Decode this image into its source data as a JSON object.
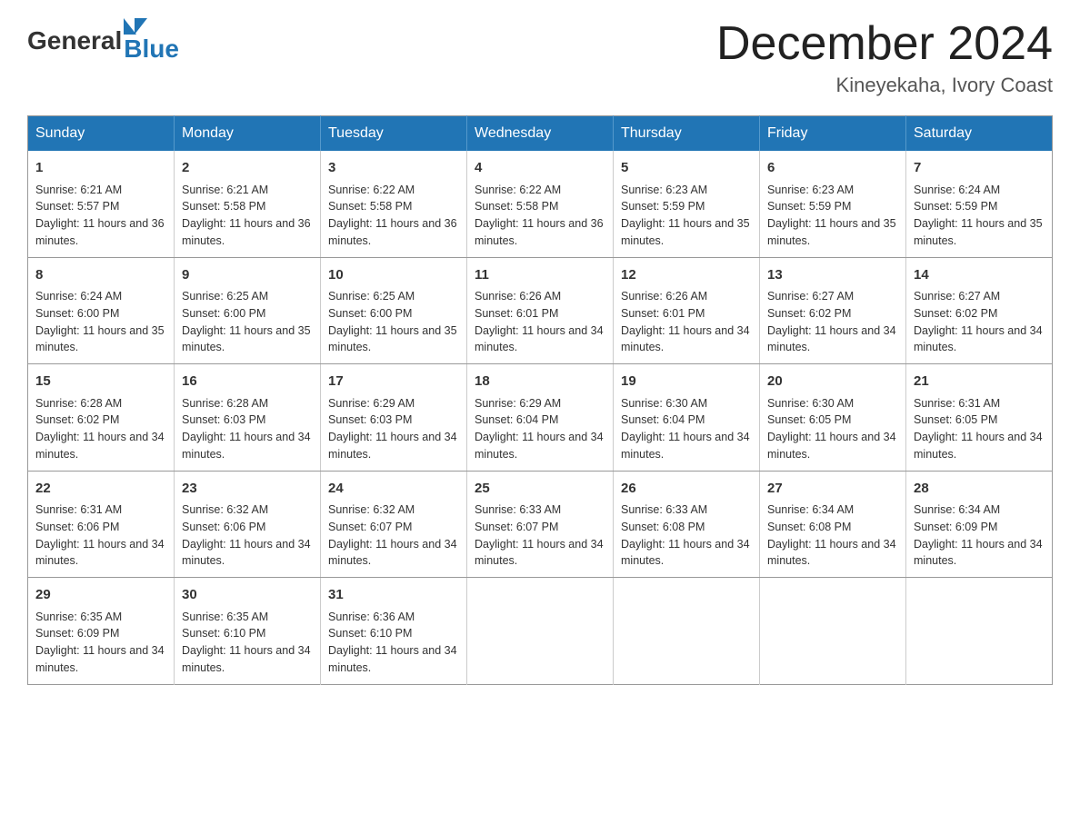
{
  "logo": {
    "general": "General",
    "blue": "Blue"
  },
  "title": "December 2024",
  "location": "Kineyekaha, Ivory Coast",
  "days_of_week": [
    "Sunday",
    "Monday",
    "Tuesday",
    "Wednesday",
    "Thursday",
    "Friday",
    "Saturday"
  ],
  "weeks": [
    [
      {
        "day": "1",
        "sunrise": "6:21 AM",
        "sunset": "5:57 PM",
        "daylight": "11 hours and 36 minutes."
      },
      {
        "day": "2",
        "sunrise": "6:21 AM",
        "sunset": "5:58 PM",
        "daylight": "11 hours and 36 minutes."
      },
      {
        "day": "3",
        "sunrise": "6:22 AM",
        "sunset": "5:58 PM",
        "daylight": "11 hours and 36 minutes."
      },
      {
        "day": "4",
        "sunrise": "6:22 AM",
        "sunset": "5:58 PM",
        "daylight": "11 hours and 36 minutes."
      },
      {
        "day": "5",
        "sunrise": "6:23 AM",
        "sunset": "5:59 PM",
        "daylight": "11 hours and 35 minutes."
      },
      {
        "day": "6",
        "sunrise": "6:23 AM",
        "sunset": "5:59 PM",
        "daylight": "11 hours and 35 minutes."
      },
      {
        "day": "7",
        "sunrise": "6:24 AM",
        "sunset": "5:59 PM",
        "daylight": "11 hours and 35 minutes."
      }
    ],
    [
      {
        "day": "8",
        "sunrise": "6:24 AM",
        "sunset": "6:00 PM",
        "daylight": "11 hours and 35 minutes."
      },
      {
        "day": "9",
        "sunrise": "6:25 AM",
        "sunset": "6:00 PM",
        "daylight": "11 hours and 35 minutes."
      },
      {
        "day": "10",
        "sunrise": "6:25 AM",
        "sunset": "6:00 PM",
        "daylight": "11 hours and 35 minutes."
      },
      {
        "day": "11",
        "sunrise": "6:26 AM",
        "sunset": "6:01 PM",
        "daylight": "11 hours and 34 minutes."
      },
      {
        "day": "12",
        "sunrise": "6:26 AM",
        "sunset": "6:01 PM",
        "daylight": "11 hours and 34 minutes."
      },
      {
        "day": "13",
        "sunrise": "6:27 AM",
        "sunset": "6:02 PM",
        "daylight": "11 hours and 34 minutes."
      },
      {
        "day": "14",
        "sunrise": "6:27 AM",
        "sunset": "6:02 PM",
        "daylight": "11 hours and 34 minutes."
      }
    ],
    [
      {
        "day": "15",
        "sunrise": "6:28 AM",
        "sunset": "6:02 PM",
        "daylight": "11 hours and 34 minutes."
      },
      {
        "day": "16",
        "sunrise": "6:28 AM",
        "sunset": "6:03 PM",
        "daylight": "11 hours and 34 minutes."
      },
      {
        "day": "17",
        "sunrise": "6:29 AM",
        "sunset": "6:03 PM",
        "daylight": "11 hours and 34 minutes."
      },
      {
        "day": "18",
        "sunrise": "6:29 AM",
        "sunset": "6:04 PM",
        "daylight": "11 hours and 34 minutes."
      },
      {
        "day": "19",
        "sunrise": "6:30 AM",
        "sunset": "6:04 PM",
        "daylight": "11 hours and 34 minutes."
      },
      {
        "day": "20",
        "sunrise": "6:30 AM",
        "sunset": "6:05 PM",
        "daylight": "11 hours and 34 minutes."
      },
      {
        "day": "21",
        "sunrise": "6:31 AM",
        "sunset": "6:05 PM",
        "daylight": "11 hours and 34 minutes."
      }
    ],
    [
      {
        "day": "22",
        "sunrise": "6:31 AM",
        "sunset": "6:06 PM",
        "daylight": "11 hours and 34 minutes."
      },
      {
        "day": "23",
        "sunrise": "6:32 AM",
        "sunset": "6:06 PM",
        "daylight": "11 hours and 34 minutes."
      },
      {
        "day": "24",
        "sunrise": "6:32 AM",
        "sunset": "6:07 PM",
        "daylight": "11 hours and 34 minutes."
      },
      {
        "day": "25",
        "sunrise": "6:33 AM",
        "sunset": "6:07 PM",
        "daylight": "11 hours and 34 minutes."
      },
      {
        "day": "26",
        "sunrise": "6:33 AM",
        "sunset": "6:08 PM",
        "daylight": "11 hours and 34 minutes."
      },
      {
        "day": "27",
        "sunrise": "6:34 AM",
        "sunset": "6:08 PM",
        "daylight": "11 hours and 34 minutes."
      },
      {
        "day": "28",
        "sunrise": "6:34 AM",
        "sunset": "6:09 PM",
        "daylight": "11 hours and 34 minutes."
      }
    ],
    [
      {
        "day": "29",
        "sunrise": "6:35 AM",
        "sunset": "6:09 PM",
        "daylight": "11 hours and 34 minutes."
      },
      {
        "day": "30",
        "sunrise": "6:35 AM",
        "sunset": "6:10 PM",
        "daylight": "11 hours and 34 minutes."
      },
      {
        "day": "31",
        "sunrise": "6:36 AM",
        "sunset": "6:10 PM",
        "daylight": "11 hours and 34 minutes."
      },
      null,
      null,
      null,
      null
    ]
  ]
}
